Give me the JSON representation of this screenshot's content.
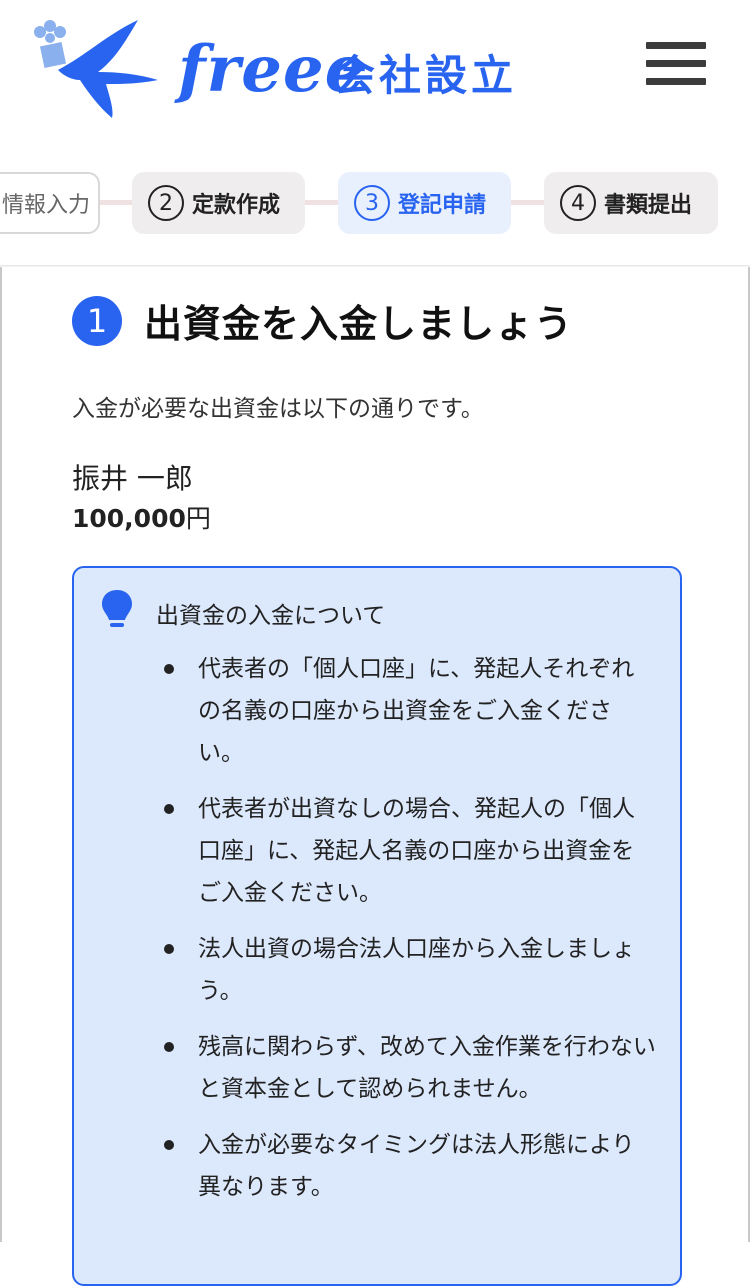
{
  "header": {
    "logo_text": "freee",
    "logo_sub": "会社設立",
    "brand_color": "#2864f0",
    "menu_icon": "hamburger-icon"
  },
  "stepper": {
    "steps": [
      {
        "label": "情報入力",
        "state": "done"
      },
      {
        "num": "2",
        "label": "定款作成",
        "state": "normal"
      },
      {
        "num": "3",
        "label": "登記申請",
        "state": "current"
      },
      {
        "num": "4",
        "label": "書類提出",
        "state": "normal"
      }
    ]
  },
  "section": {
    "num": "1",
    "title": "出資金を入金しましょう",
    "intro": "入金が必要な出資金は以下の通りです。",
    "payer_name": "振井 一郎",
    "amount_value": "100,000",
    "amount_unit": "円"
  },
  "info": {
    "icon": "lightbulb-icon",
    "title": "出資金の入金について",
    "items": [
      "代表者の「個人口座」に、発起人それぞれの名義の口座から出資金をご入金ください。",
      "代表者が出資なしの場合、発起人の「個人口座」に、発起人名義の口座から出資金をご入金ください。",
      "法人出資の場合法人口座から入金しましょう。",
      "残高に関わらず、改めて入金作業を行わないと資本金として認められません。",
      "入金が必要なタイミングは法人形態により異なります。"
    ]
  }
}
